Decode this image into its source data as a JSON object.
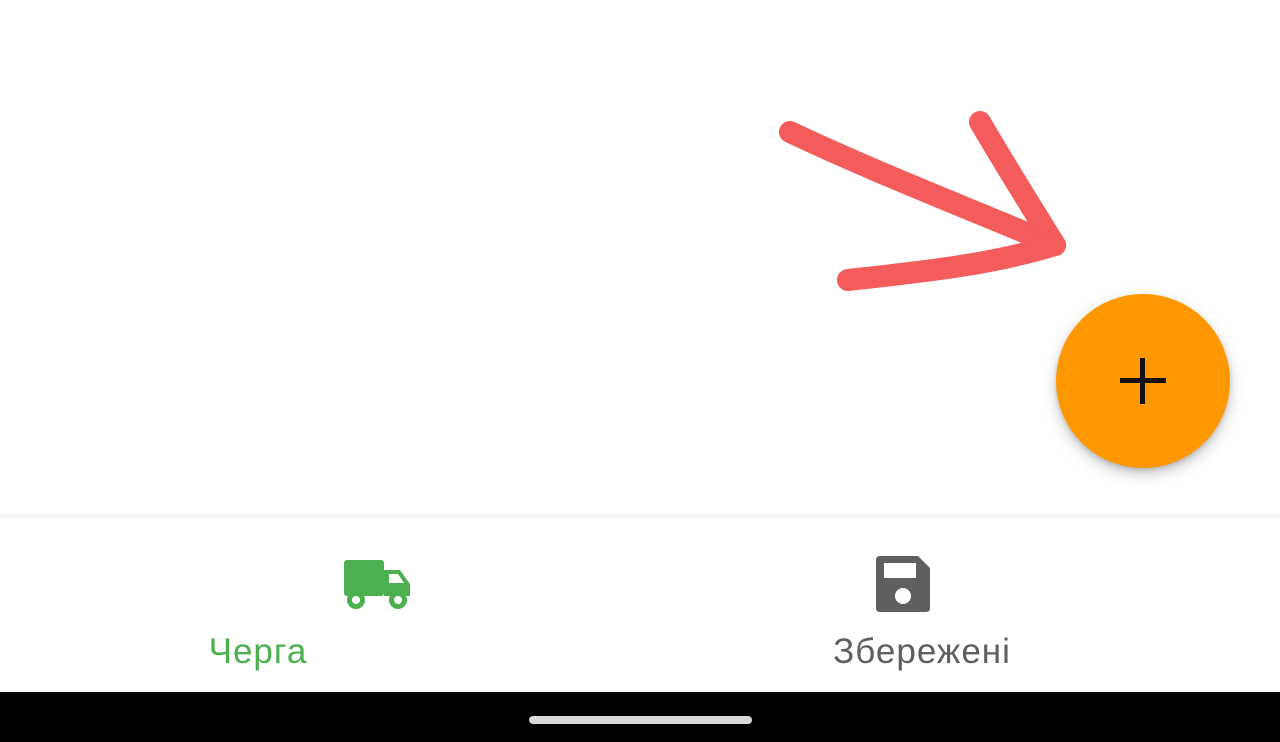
{
  "colors": {
    "fab_background": "#FF9800",
    "fab_icon": "#111111",
    "nav_active": "#4CAF50",
    "nav_inactive": "#5f5f5f",
    "annotation_arrow": "#F45B5B",
    "system_bar": "#000000"
  },
  "fab": {
    "icon": "plus-icon"
  },
  "bottom_nav": {
    "items": [
      {
        "label": "Черга",
        "icon": "truck-icon",
        "active": true
      },
      {
        "label": "Збережені",
        "icon": "save-icon",
        "active": false
      }
    ]
  },
  "annotation": {
    "icon": "hand-drawn-arrow-icon"
  }
}
